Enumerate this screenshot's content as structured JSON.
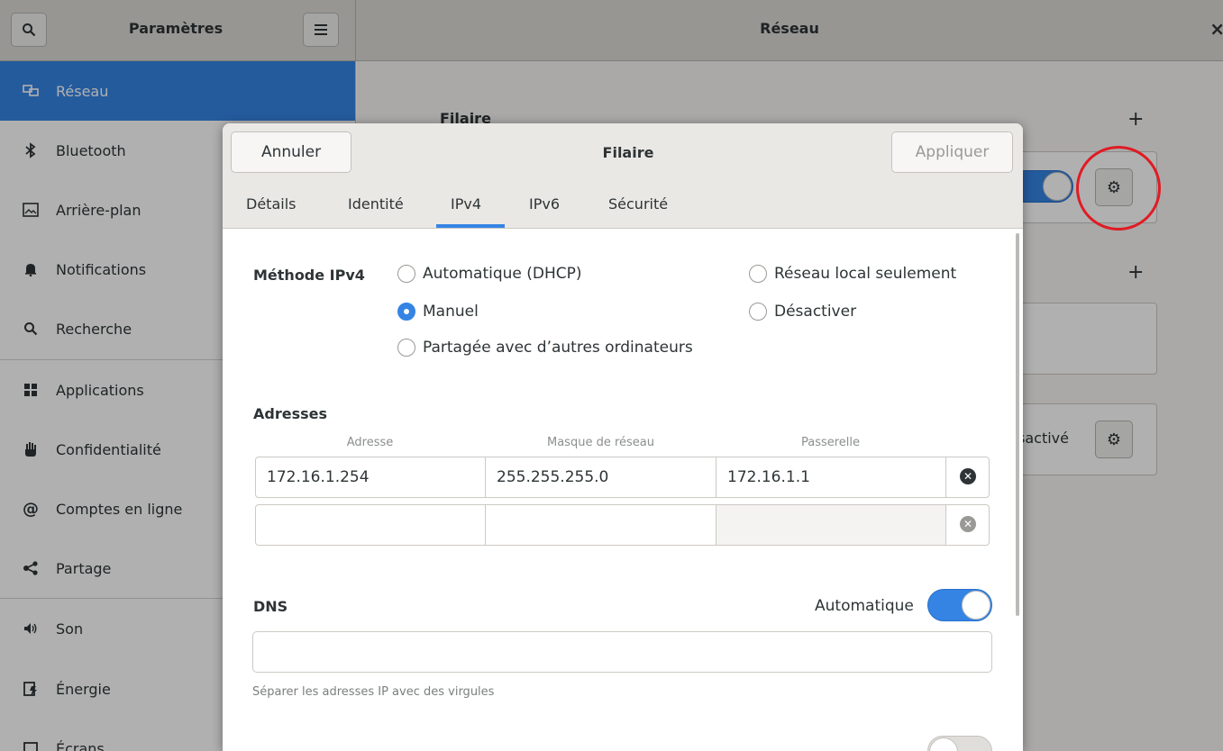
{
  "headerbar": {
    "title_left": "Paramètres",
    "title_right": "Réseau",
    "search_icon": "search-icon",
    "menu_icon": "hamburger-menu-icon",
    "close_glyph": "×"
  },
  "sidebar": {
    "items": [
      {
        "label": "Réseau",
        "icon": "network-icon",
        "glyph": "🖧"
      },
      {
        "label": "Bluetooth",
        "icon": "bluetooth-icon",
        "glyph": "✱"
      },
      {
        "label": "Arrière-plan",
        "icon": "background-icon",
        "glyph": "▣"
      },
      {
        "label": "Notifications",
        "icon": "bell-icon",
        "glyph": "🔔"
      },
      {
        "label": "Recherche",
        "icon": "search-icon",
        "glyph": "🔍"
      },
      {
        "label": "Applications",
        "icon": "applications-icon",
        "glyph": "▦"
      },
      {
        "label": "Confidentialité",
        "icon": "privacy-hand-icon",
        "glyph": "✋"
      },
      {
        "label": "Comptes en ligne",
        "icon": "online-accounts-icon",
        "glyph": "@"
      },
      {
        "label": "Partage",
        "icon": "share-icon",
        "glyph": "<"
      },
      {
        "label": "Son",
        "icon": "speaker-icon",
        "glyph": "🔈"
      },
      {
        "label": "Énergie",
        "icon": "power-icon",
        "glyph": "⚡"
      },
      {
        "label": "Écrans",
        "icon": "display-icon",
        "glyph": "▢"
      }
    ]
  },
  "main": {
    "section_wired": "Filaire",
    "plus": "+",
    "disabled_label": "sactivé",
    "gear_glyph": "⚙"
  },
  "dialog": {
    "title": "Filaire",
    "cancel_label": "Annuler",
    "apply_label": "Appliquer",
    "tabs": [
      "Détails",
      "Identité",
      "IPv4",
      "IPv6",
      "Sécurité"
    ],
    "ipv4_method_label": "Méthode IPv4",
    "methods": {
      "auto": "Automatique (DHCP)",
      "local": "Réseau local seulement",
      "manual": "Manuel",
      "disable": "Désactiver",
      "shared": "Partagée avec d’autres ordinateurs"
    },
    "addresses_label": "Adresses",
    "columns": [
      "Adresse",
      "Masque de réseau",
      "Passerelle"
    ],
    "rows": [
      {
        "address": "172.16.1.254",
        "netmask": "255.255.255.0",
        "gateway": "172.16.1.1"
      },
      {
        "address": "",
        "netmask": "",
        "gateway": ""
      }
    ],
    "delete_glyph": "✕",
    "dns_label": "DNS",
    "dns_auto_label": "Automatique",
    "dns_value": "",
    "dns_hint": "Séparer les adresses IP avec des virgules"
  }
}
